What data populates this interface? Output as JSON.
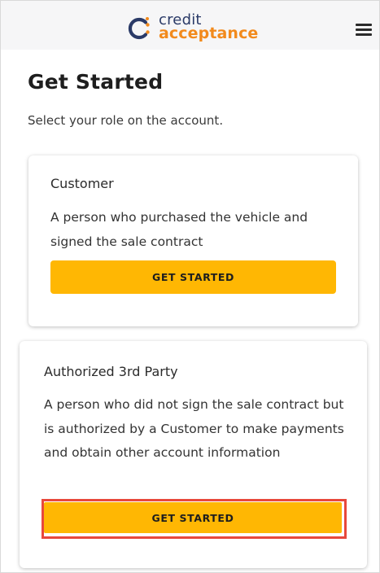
{
  "header": {
    "logo_line1": "credit",
    "logo_line2": "acceptance",
    "menu_icon": "hamburger-menu-icon"
  },
  "main": {
    "title": "Get Started",
    "subtitle": "Select your role on the account."
  },
  "cards": [
    {
      "title": "Customer",
      "description": "A person who purchased the vehicle and signed the sale contract",
      "button_label": "GET STARTED"
    },
    {
      "title": "Authorized 3rd Party",
      "description": "A person who did not sign the sale contract but is authorized by a Customer to make payments and obtain other account information",
      "button_label": "GET STARTED"
    }
  ],
  "colors": {
    "brand_navy": "#2a3a67",
    "brand_orange": "#f28a1c",
    "button_yellow": "#ffb703",
    "highlight_red": "#e8483c",
    "header_bg": "#f6f6f7"
  }
}
